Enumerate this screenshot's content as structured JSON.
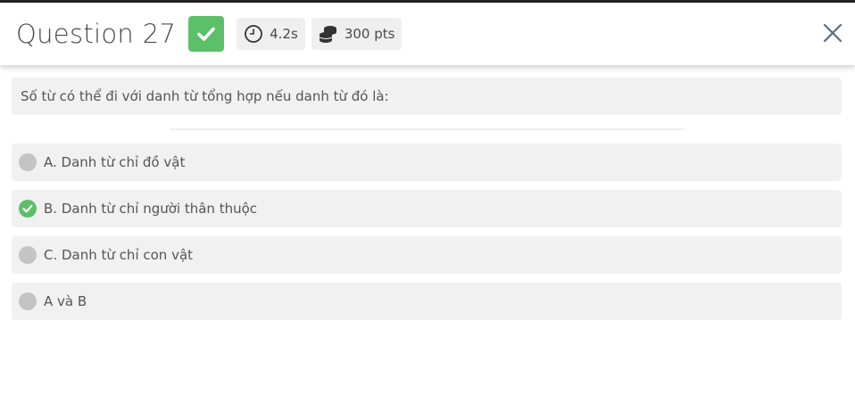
{
  "header": {
    "title": "Question 27",
    "result_icon": "check-icon",
    "time": {
      "icon": "clock-icon",
      "label": "4.2s"
    },
    "points": {
      "icon": "coins-icon",
      "label": "300 pts"
    },
    "close_icon": "close-icon"
  },
  "question": {
    "text": "Số từ có thể đi với danh từ tổng hợp nếu danh từ đó là:"
  },
  "options": [
    {
      "label": "A. Danh từ chỉ đồ vật",
      "status": "neutral"
    },
    {
      "label": "B. Danh từ chỉ người thân thuộc",
      "status": "correct"
    },
    {
      "label": "C. Danh từ chỉ con vật",
      "status": "neutral"
    },
    {
      "label": "A và B",
      "status": "neutral"
    }
  ],
  "colors": {
    "correct": "#5cbf6a",
    "neutral": "#c4c4c4",
    "panel": "#f1f1f1"
  }
}
